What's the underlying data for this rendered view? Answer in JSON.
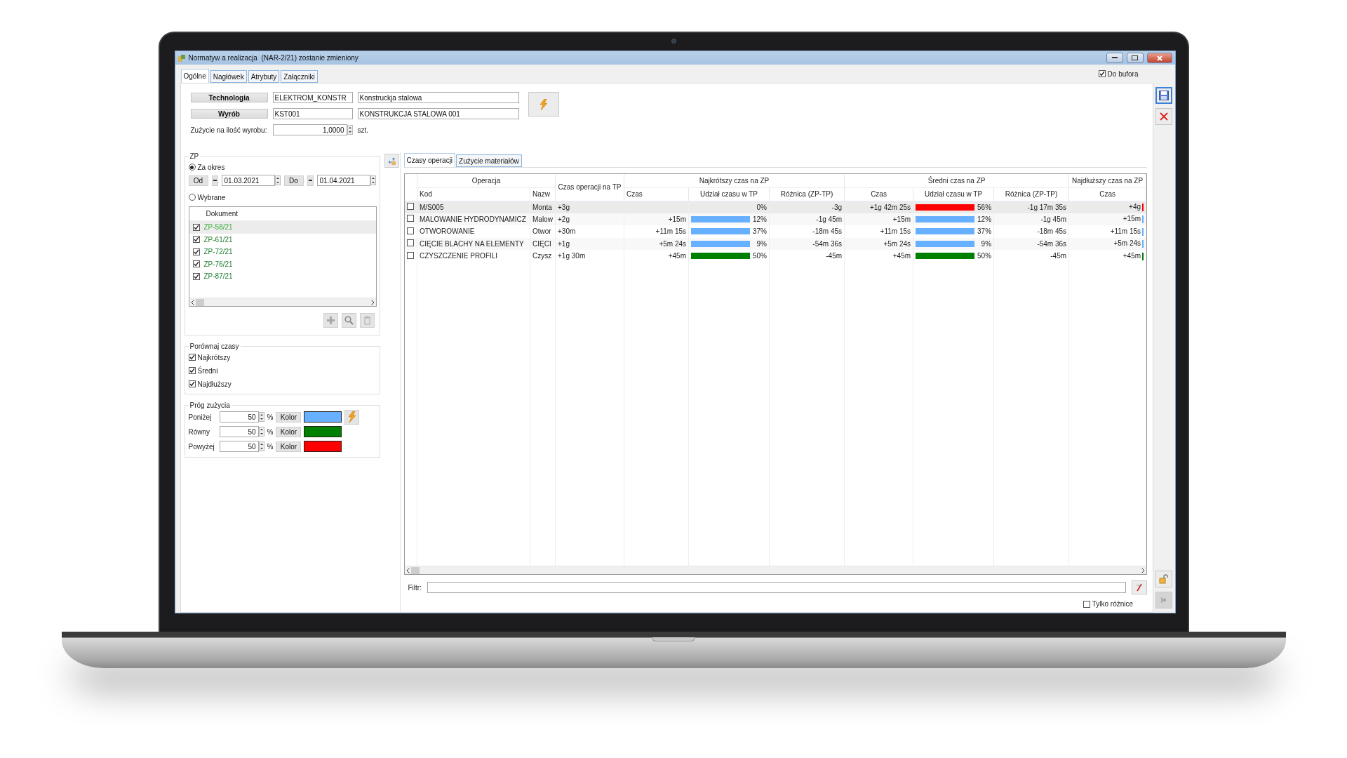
{
  "window": {
    "title": "Normatyw a realizacja  (NAR-2/21) zostanie zmieniony"
  },
  "tabs": [
    {
      "label": "Ogólne",
      "selected": true
    },
    {
      "label": "Nagłówek",
      "selected": false
    },
    {
      "label": "Atrybuty",
      "selected": false
    },
    {
      "label": "Załączniki",
      "selected": false
    }
  ],
  "buffer": {
    "label": "Do bufora",
    "checked": true
  },
  "form": {
    "rows": [
      {
        "label": "Technologia",
        "code": "ELEKTROM_KONSTR",
        "name": "Konstruckja stalowa"
      },
      {
        "label": "Wyrób",
        "code": "KST001",
        "name": "KONSTRUKCJA STALOWA 001"
      }
    ],
    "usage": {
      "label": "Zużycie na ilość wyrobu:",
      "value": "1,0000",
      "unit": "szt."
    }
  },
  "zp": {
    "title": "ZP",
    "options": [
      {
        "label": "Za okres",
        "selected": true
      },
      {
        "label": "Wybrane",
        "selected": false
      }
    ],
    "from": {
      "label": "Od",
      "value": "01.03.2021"
    },
    "to": {
      "label": "Do",
      "value": "01.04.2021"
    },
    "list": {
      "header": "Dokument",
      "items": [
        {
          "label": "ZP-58/21",
          "checked": true,
          "selected": true
        },
        {
          "label": "ZP-61/21",
          "checked": true,
          "selected": false
        },
        {
          "label": "ZP-72/21",
          "checked": true,
          "selected": false
        },
        {
          "label": "ZP-76/21",
          "checked": true,
          "selected": false
        },
        {
          "label": "ZP-87/21",
          "checked": true,
          "selected": false
        }
      ]
    }
  },
  "compare": {
    "title": "Porównaj czasy",
    "items": [
      {
        "label": "Najkrótszy",
        "checked": true
      },
      {
        "label": "Średni",
        "checked": true
      },
      {
        "label": "Najdłuższy",
        "checked": true
      }
    ]
  },
  "threshold": {
    "title": "Próg zużycia",
    "rows": [
      {
        "label": "Poniżej",
        "value": "50",
        "unit": "%",
        "button": "Kolor",
        "color": "#66b0ff"
      },
      {
        "label": "Równy",
        "value": "50",
        "unit": "%",
        "button": "Kolor",
        "color": "#008000"
      },
      {
        "label": "Powyżej",
        "value": "50",
        "unit": "%",
        "button": "Kolor",
        "color": "#ff0000"
      }
    ]
  },
  "result_tabs": [
    {
      "label": "Czasy operacji",
      "selected": true
    },
    {
      "label": "Zużycie materiałów",
      "selected": false
    }
  ],
  "table": {
    "operation": "Operacja",
    "code": "Kod",
    "name": "Nazw",
    "tp_time": "Czas operacji na TP",
    "groups": [
      {
        "kind": "full",
        "title": "Najkrótszy czas na ZP",
        "columns": [
          "Czas",
          "Udział czasu w TP",
          "Różnica (ZP-TP)"
        ]
      },
      {
        "kind": "full",
        "title": "Średni czas na ZP",
        "columns": [
          "Czas",
          "Udział czasu w TP",
          "Różnica (ZP-TP)"
        ]
      },
      {
        "kind": "time_only",
        "title": "Najdłuższy czas na ZP",
        "columns": [
          "Czas"
        ]
      }
    ],
    "rows": [
      {
        "selected": true,
        "checked": false,
        "code": "M/S005",
        "name": "Monta",
        "tp_time": "+3g",
        "stats": [
          {
            "share": "0%",
            "diff": "-3g"
          },
          {
            "time": "+1g 42m 25s",
            "color": "#ff0000",
            "share": "56%",
            "diff": "-1g 17m 35s"
          },
          {
            "time": "+4g",
            "color": "#ff0000"
          }
        ]
      },
      {
        "selected": false,
        "checked": false,
        "code": "MALOWANIE HYDRODYNAMICZ",
        "name": "Malow",
        "tp_time": "+2g",
        "stats": [
          {
            "time": "+15m",
            "color": "#66b0ff",
            "share": "12%",
            "diff": "-1g 45m"
          },
          {
            "time": "+15m",
            "color": "#66b0ff",
            "share": "12%",
            "diff": "-1g 45m"
          },
          {
            "time": "+15m",
            "color": "#66b0ff"
          }
        ]
      },
      {
        "selected": false,
        "checked": false,
        "code": "OTWOROWANIE",
        "name": "Otwor",
        "tp_time": "+30m",
        "stats": [
          {
            "time": "+11m 15s",
            "color": "#66b0ff",
            "share": "37%",
            "diff": "-18m 45s"
          },
          {
            "time": "+11m 15s",
            "color": "#66b0ff",
            "share": "37%",
            "diff": "-18m 45s"
          },
          {
            "time": "+11m 15s",
            "color": "#66b0ff"
          }
        ]
      },
      {
        "selected": false,
        "checked": false,
        "code": "CIĘCIE BLACHY NA ELEMENTY",
        "name": "CIĘCI",
        "tp_time": "+1g",
        "stats": [
          {
            "time": "+5m 24s",
            "color": "#66b0ff",
            "share": "9%",
            "diff": "-54m 36s"
          },
          {
            "time": "+5m 24s",
            "color": "#66b0ff",
            "share": "9%",
            "diff": "-54m 36s"
          },
          {
            "time": "+5m 24s",
            "color": "#66b0ff"
          }
        ]
      },
      {
        "selected": false,
        "checked": false,
        "code": "CZYSZCZENIE PROFILI",
        "name": "Czysz",
        "tp_time": "+1g 30m",
        "stats": [
          {
            "time": "+45m",
            "color": "#008000",
            "share": "50%",
            "diff": "-45m"
          },
          {
            "time": "+45m",
            "color": "#008000",
            "share": "50%",
            "diff": "-45m"
          },
          {
            "time": "+45m",
            "color": "#008000"
          }
        ]
      }
    ]
  },
  "filter": {
    "label": "Filtr:"
  },
  "only_diff": {
    "label": "Tylko różnice",
    "checked": false
  }
}
